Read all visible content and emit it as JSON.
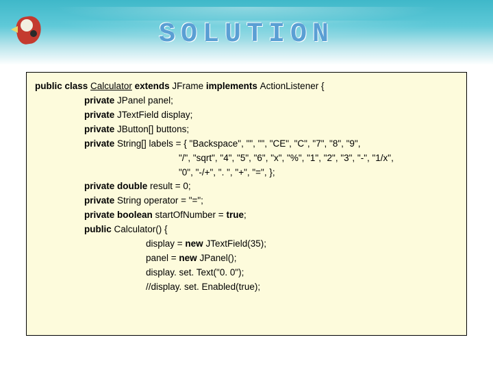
{
  "title": "SOLUTION",
  "code": {
    "l1a": "public class ",
    "l1b": "Calculator",
    "l1c": " extends ",
    "l1d": "JFrame ",
    "l1e": "implements ",
    "l1f": "ActionListener {",
    "l2a": "private ",
    "l2b": "JPanel panel;",
    "l3a": "private ",
    "l3b": "JTextField display;",
    "l4a": "private ",
    "l4b": "JButton[] buttons;",
    "l5a": "private ",
    "l5b": "String[] labels = { \"Backspace\", \"\", \"\", \"CE\", \"C\", \"7\", \"8\", \"9\",",
    "l6": "\"/\", \"sqrt\", \"4\", \"5\", \"6\", \"x\", \"%\", \"1\", \"2\", \"3\", \"-\", \"1/x\",",
    "l7": "\"0\", \"-/+\", \". \", \"+\", \"=\", };",
    "l8a": "private double ",
    "l8b": "result = 0;",
    "l9a": "private ",
    "l9b": "String operator = \"=\";",
    "l10a": "private boolean ",
    "l10b": "startOfNumber = ",
    "l10c": "true",
    "l10d": ";",
    "l11a": "public ",
    "l11b": "Calculator() {",
    "l12a": "display = ",
    "l12b": "new ",
    "l12c": "JTextField(35);",
    "l13a": "panel = ",
    "l13b": "new ",
    "l13c": "JPanel();",
    "l14": "display. set. Text(\"0. 0\");",
    "l15": "//display. set. Enabled(true);"
  }
}
